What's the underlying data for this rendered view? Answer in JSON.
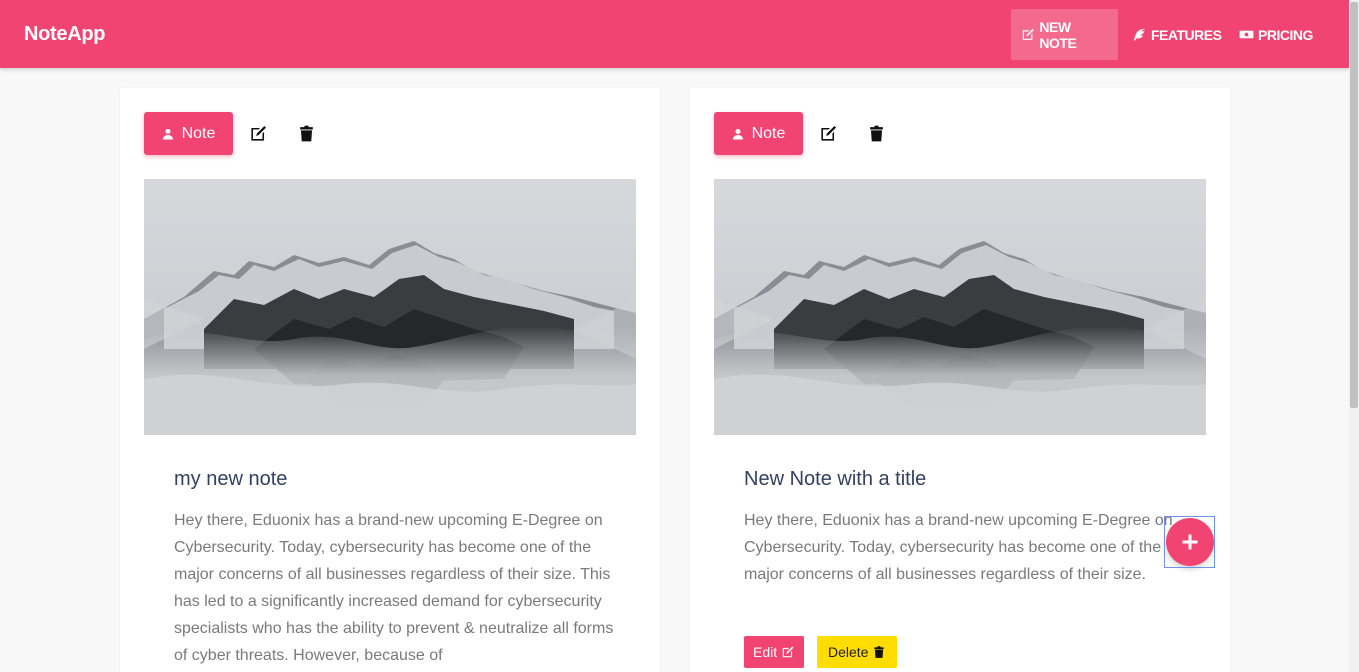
{
  "brand": "NoteApp",
  "nav": {
    "new_note": "NEW NOTE",
    "features": "FEATURES",
    "pricing": "PRICING"
  },
  "colors": {
    "primary": "#f24472",
    "warning": "#ffdd00"
  },
  "cards": [
    {
      "badge": "Note",
      "title": "my new note",
      "text": "Hey there, Eduonix has a brand-new upcoming E-Degree on Cybersecurity. Today, cybersecurity has become one of the major concerns of all businesses regardless of their size. This has led to a significantly increased demand for cybersecurity specialists who has the ability to prevent & neutralize all forms of cyber threats. However, because of",
      "image_icon": "mountain-image"
    },
    {
      "badge": "Note",
      "title": "New Note with a title",
      "text": "Hey there, Eduonix has a brand-new upcoming E-Degree on Cybersecurity. Today, cybersecurity has become one of the major concerns of all businesses regardless of their size.",
      "edit_label": "Edit",
      "delete_label": "Delete",
      "image_icon": "mountain-image"
    }
  ],
  "fab_icon": "plus-icon"
}
